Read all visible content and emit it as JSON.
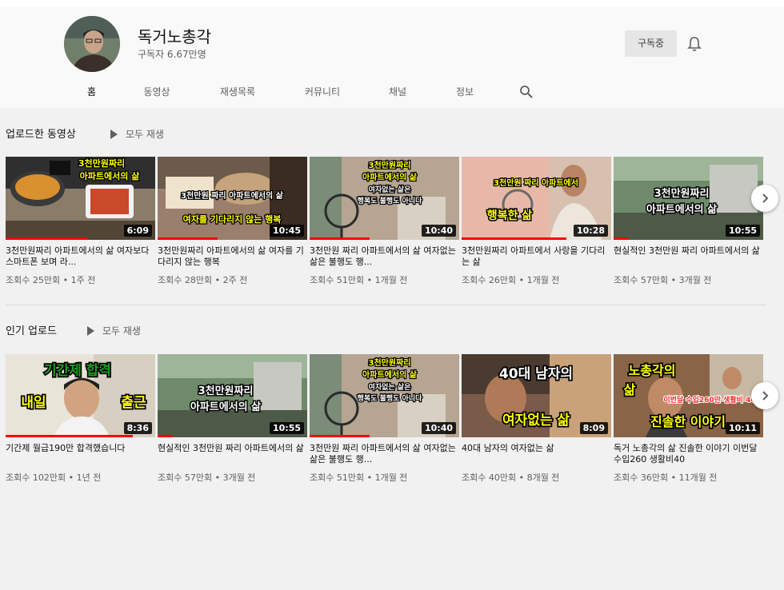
{
  "channel": {
    "name": "독거노총각",
    "subscribers": "구독자 6.67만명",
    "subscribe_label": "구독중"
  },
  "tabs": [
    {
      "label": "홈",
      "active": true
    },
    {
      "label": "동영상"
    },
    {
      "label": "재생목록"
    },
    {
      "label": "커뮤니티"
    },
    {
      "label": "채널"
    },
    {
      "label": "정보"
    }
  ],
  "sections": [
    {
      "title": "업로드한 동영상",
      "play_all": "모두 재생",
      "videos": [
        {
          "title": "3천만원짜리 아파트에서의 삶 여자보다 스마트폰 보며 라...",
          "meta": "조회수 25만회 • 1주 전",
          "duration": "6:09",
          "overlay": [
            "3천만원짜리",
            "아파트에서의 삶"
          ],
          "progress": 0.55
        },
        {
          "title": "3천만원짜리 아파트에서의 삶 여자를 기다리지 않는 행복",
          "meta": "조회수 28만회 • 2주 전",
          "duration": "10:45",
          "overlay": [
            "3천만원 짜리 아파트에서의 삶",
            "여자를 기다리지 않는 행복"
          ],
          "progress": 0.4
        },
        {
          "title": "3천만원 짜리 아파트에서의 삶 여자없는 삶은 불행도 행...",
          "meta": "조회수 51만회 • 1개월 전",
          "duration": "10:40",
          "overlay": [
            "3천만원짜리",
            "아파트에서의 삶",
            "여자없는 삶은",
            "행복도 불행도 아니다"
          ],
          "progress": 0.4
        },
        {
          "title": "3천만원짜리 아파트에서 사랑을 기다리는 삶",
          "meta": "조회수 26만회 • 1개월 전",
          "duration": "10:28",
          "overlay": [
            "3천만원 짜리 아파트에서",
            "행복한 삶"
          ],
          "progress": 0.7
        },
        {
          "title": "현실적인 3천만원 짜리 아파트에서의 삶",
          "meta": "조회수 57만회 • 3개월 전",
          "duration": "10:55",
          "overlay": [
            "3천만원짜리",
            "아파트에서의 삶"
          ],
          "progress": 0.1
        }
      ]
    },
    {
      "title": "인기 업로드",
      "play_all": "모두 재생",
      "videos": [
        {
          "title": "기간제 월급190만 합격했습니다",
          "meta": "조회수 102만회 • 1년 전",
          "duration": "8:36",
          "overlay": [
            "기간제 합격",
            "내일",
            "출근"
          ],
          "progress": 0.85
        },
        {
          "title": "현실적인 3천만원 짜리 아파트에서의 삶",
          "meta": "조회수 57만회 • 3개월 전",
          "duration": "10:55",
          "overlay": [
            "3천만원짜리",
            "아파트에서의 삶"
          ],
          "progress": 0.1
        },
        {
          "title": "3천만원 짜리 아파트에서의 삶 여자없는 삶은 불행도 행...",
          "meta": "조회수 51만회 • 1개월 전",
          "duration": "10:40",
          "overlay": [
            "3천만원짜리",
            "아파트에서의 삶",
            "여자없는 삶은",
            "행복도 불행도 아니다"
          ],
          "progress": 0.4
        },
        {
          "title": "40대 남자의 여자없는 삶",
          "meta": "조회수 40만회 • 8개월 전",
          "duration": "8:09",
          "overlay": [
            "40대 남자의",
            "여자없는 삶"
          ],
          "progress": 0.0
        },
        {
          "title": "독거 노총각의 삶 진솔한 이야기 이번달수입260 생활비40",
          "meta": "조회수 36만회 • 11개월 전",
          "duration": "10:11",
          "overlay": [
            "노총각의",
            "삶",
            "이번달 수입260만 생활비 40",
            "진솔한 이야기"
          ],
          "progress": 0.0
        }
      ]
    }
  ],
  "colors": {
    "progress": "#ff0000",
    "overlay_yellow": "#ffff00",
    "background": "#f1f1f1"
  },
  "icons": {
    "bell": "bell-icon",
    "search": "search-icon",
    "play": "play-icon",
    "next": "chevron-right-icon"
  }
}
